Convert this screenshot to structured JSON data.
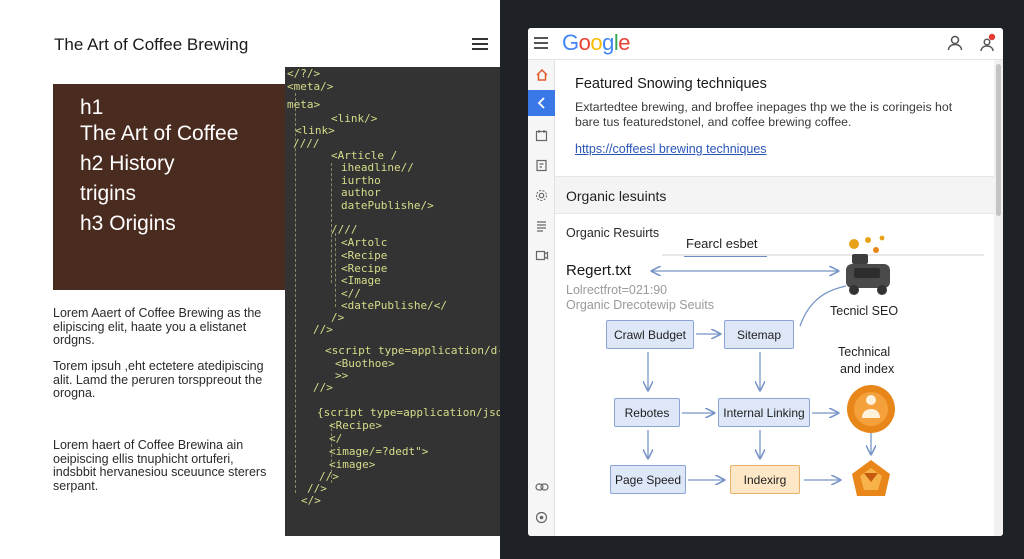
{
  "article": {
    "title": "The Art of Coffee Brewing",
    "heading_lines": [
      "h1",
      "The Art of Coffee",
      "h2 History",
      "trigins",
      "h3 Origins"
    ],
    "paragraphs": [
      [
        "Lorem Aaert of Coffee Brewing as the",
        "elipiscing elit, haate you a elistanet",
        "ordgns."
      ],
      [
        "Torem ipsuh ,eht ectetere atedipiscing",
        "alit. Lamd the peruren torsppreout the",
        "orogna."
      ],
      [
        "Lorem haert of Coffee Brewina ain",
        "oeipiscing ellis tnuphicht ortuferi,",
        "indsbbit hervanesiou sceuunce sterers",
        "serpant."
      ]
    ]
  },
  "code": {
    "lines": [
      "</?/>",
      "<meta/>",
      "meta>",
      "<link/>",
      "<link>",
      "////",
      "<Article /",
      "iheadline//",
      "iurtho",
      "author",
      "datePublishe/>",
      "////",
      "<Artolc",
      "<Recipe",
      "<Recipe",
      "<Image",
      "<//",
      "<datePublishe/</",
      "/>",
      "//>",
      "<script type=application/d-json",
      "<Buothoe>",
      ">>",
      "//>",
      "{script type=application/json\">",
      "<Recipe>",
      "</",
      "<image/=?dedt\">",
      "<image>",
      "//>",
      "//>",
      "</>"
    ]
  },
  "browser": {
    "logo": "Google",
    "featured": {
      "title": "Featured Snowing techniques",
      "snippet": [
        "Extartedtee brewing, and broffee inepages thp we the is coringeis hot",
        "bare tus featuredstonel, and coffee brewing coffee."
      ],
      "link": "https://coffeesl brewing techniques"
    },
    "organic_heading": "Organic lesuints",
    "organic_sub": "Organic Resuirts",
    "search_set": "Fearcl esbet",
    "robots_title": "Regert.txt",
    "gray_lines": [
      "Lolrectfrot=021:90",
      "Organic Drecotewip Seuits"
    ],
    "tech_seo": "Tecnicl SEO",
    "tech_index": [
      "Technical",
      "and index"
    ],
    "flow_boxes": {
      "crawl_budget": "Crawl Budget",
      "sitemap": "Sitemap",
      "robots": "Rebotes",
      "internal_linking": "Internal Linking",
      "page_speed": "Page Speed",
      "indexing": "Indexirg"
    },
    "colors": {
      "accent_blue": "#2a55b8",
      "flow_blue": "#dde7f8",
      "flow_orange": "#fde7c6",
      "heading_brown": "#4a2b1f",
      "icon_orange": "#e8861a"
    }
  }
}
